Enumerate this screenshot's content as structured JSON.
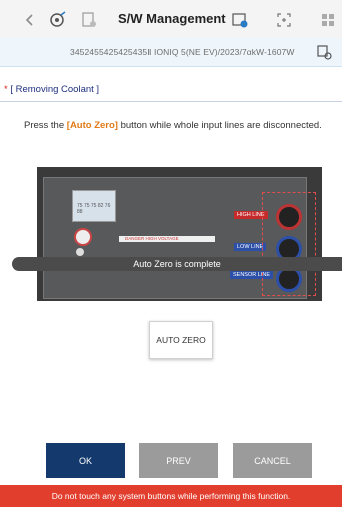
{
  "header": {
    "title": "S/W Management",
    "icons": [
      "back-arrow-icon",
      "home-settings-icon",
      "document-tool-icon",
      "calendar-gear-icon",
      "crosshair-icon",
      "grid-icon"
    ]
  },
  "vehicle": {
    "vin_text": "3452455425425435Ⅱ IONIQ 5(NE EV)/2023/7αkW-1607W"
  },
  "section": {
    "marker": "*",
    "title": "[ Removing Coolant ]"
  },
  "instruction": {
    "prefix": "Press the ",
    "highlight": "[Auto Zero]",
    "suffix": " button while whole input lines are disconnected."
  },
  "photo": {
    "lcd_text": "75 75 75 82 76 88",
    "labels": [
      "HIGH LINE",
      "LOW LINE",
      "SENSOR LINE"
    ],
    "warning_title": "DANGER HIGH VOLTAGE"
  },
  "toast": "Auto Zero is complete",
  "auto_zero_label": "AUTO ZERO",
  "buttons": {
    "ok": "OK",
    "prev": "PREV",
    "cancel": "CANCEL"
  },
  "footer": "Do not touch any system buttons while performing this function.",
  "colors": {
    "primary": "#143a6d",
    "secondary": "#9b9b9b",
    "warning": "#e23e2e",
    "accent": "#e07a16"
  }
}
